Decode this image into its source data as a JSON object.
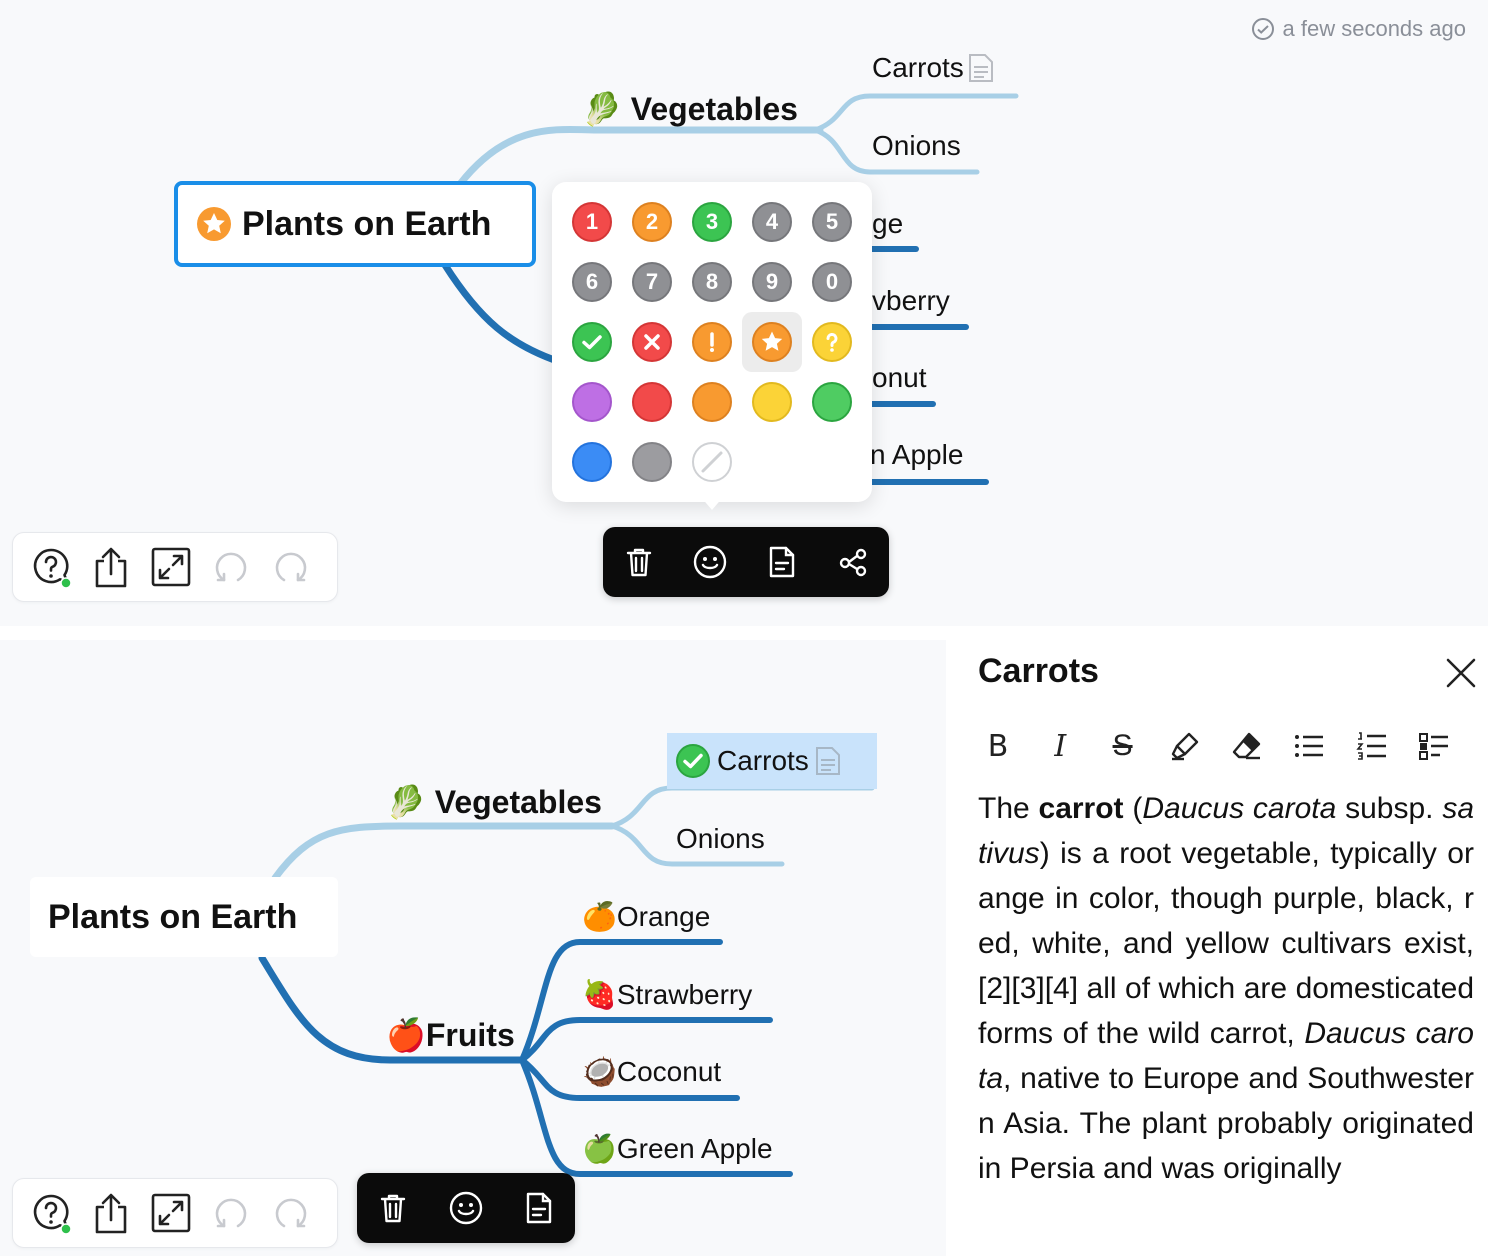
{
  "top": {
    "sync_status": "a few seconds ago",
    "root_label": "Plants on Earth",
    "vegetables_label": "Vegetables",
    "carrots_label": "Carrots",
    "onions_label": "Onions",
    "orange_partial": "ge",
    "strawberry_partial": "vberry",
    "coconut_partial": "onut",
    "apple_partial": "n Apple",
    "marker_numbers": [
      "1",
      "2",
      "3",
      "4",
      "5",
      "6",
      "7",
      "8",
      "9",
      "0"
    ]
  },
  "bottom": {
    "root_label": "Plants on Earth",
    "vegetables_label": "Vegetables",
    "carrots_label": "Carrots",
    "onions_label": "Onions",
    "fruits_label": "Fruits",
    "orange_label": "Orange",
    "strawberry_label": "Strawberry",
    "coconut_label": "Coconut",
    "apple_label": "Green Apple"
  },
  "emojis": {
    "vegetables": "🥬",
    "fruits": "🍎",
    "orange": "🍊",
    "strawberry": "🍓",
    "coconut": "🥥",
    "apple": "🍏"
  },
  "left_toolbar_icons": [
    "help-icon",
    "share-icon",
    "fullscreen-icon",
    "undo-icon",
    "redo-icon"
  ],
  "node_toolbar_icons": [
    "delete-icon",
    "emoji-icon",
    "note-icon",
    "mindmap-icon"
  ],
  "notes": {
    "title": "Carrots",
    "format_buttons": [
      "B",
      "I",
      "S",
      "highlight",
      "eraser",
      "bullet-list",
      "numbered-list",
      "checklist"
    ],
    "body": {
      "p1": "The ",
      "p2": "carrot",
      "p3": " (",
      "p4": "Daucus carota",
      "p5": " subsp. ",
      "p6": "sativus",
      "p7": ") is a root vegetable, typically orange in color, though purple, black, red, white, and yellow cultivars exist,[2][3][4] all of which are domesticated forms of the wild carrot, ",
      "p8": "Daucus carota",
      "p9": ", native to Europe and Southwestern Asia. The plant probably originated in Persia and was originally"
    }
  },
  "colors": {
    "light_branch": "#a8cfe6",
    "dark_branch": "#2170b2",
    "selection_border": "#1a8ee8",
    "selected_node_bg": "#c9e3fb",
    "marker_red": "#f24a4a",
    "marker_orange": "#f89a30",
    "marker_green": "#3cc453",
    "marker_gray": "#8f9094",
    "marker_yellow": "#fbd337",
    "marker_purple": "#be6fe4",
    "marker_blue": "#3b8cf5"
  }
}
